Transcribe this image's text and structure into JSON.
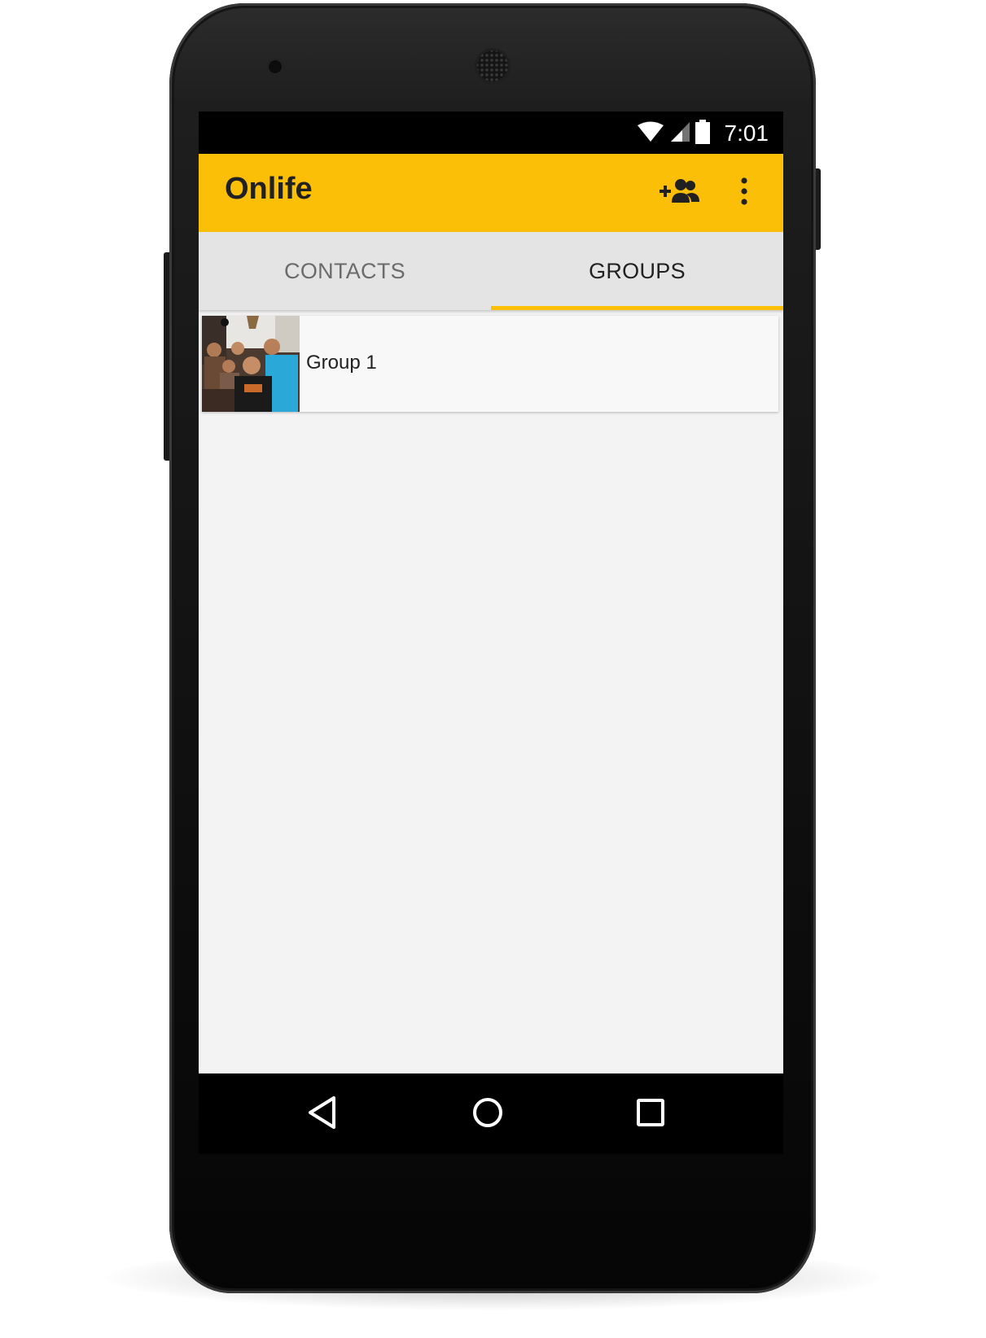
{
  "status_bar": {
    "time": "7:01",
    "icons": [
      "wifi-icon",
      "cell-signal-icon",
      "battery-icon"
    ]
  },
  "app_bar": {
    "title": "Onlife",
    "actions": [
      "group-add-icon",
      "more-vert-icon"
    ],
    "color": "#fcbf07"
  },
  "tabs": [
    {
      "label": "CONTACTS",
      "selected": false
    },
    {
      "label": "GROUPS",
      "selected": true
    }
  ],
  "groups": [
    {
      "name": "Group 1",
      "photo": "group-photo"
    }
  ],
  "nav_bar": {
    "buttons": [
      "back-icon",
      "home-icon",
      "recents-icon"
    ]
  },
  "colors": {
    "accent": "#fcbf07",
    "tab_bar": "#e4e4e4",
    "content_bg": "#f3f3f3"
  }
}
